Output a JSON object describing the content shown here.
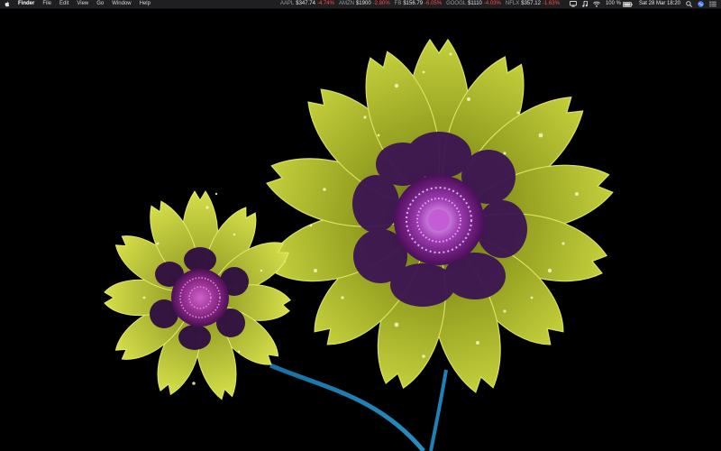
{
  "menubar": {
    "app_name": "Finder",
    "menus": [
      "File",
      "Edit",
      "View",
      "Go",
      "Window",
      "Help"
    ],
    "tickers": [
      {
        "symbol": "AAPL",
        "price": "$347.74",
        "change": "-4.74%"
      },
      {
        "symbol": "AMZN",
        "price": "$1900",
        "change": "-2.80%"
      },
      {
        "symbol": "FB",
        "price": "$156.79",
        "change": "-6.05%"
      },
      {
        "symbol": "GOOGL",
        "price": "$1110",
        "change": "-4.03%"
      },
      {
        "symbol": "NFLX",
        "price": "$357.12",
        "change": "-1.63%"
      }
    ],
    "battery_text": "100 %",
    "clock": "Sat 28 Mar  18:20",
    "status_icons": [
      "display-icon",
      "music-note-icon",
      "wifi-icon",
      "battery-icon",
      "search-icon",
      "siri-icon",
      "notification-center-icon"
    ],
    "ticker_change_color": "#ff4b4b"
  },
  "desktop": {
    "wallpaper": "ultraviolet-fluorescent-flowers",
    "background_color": "#000000"
  }
}
